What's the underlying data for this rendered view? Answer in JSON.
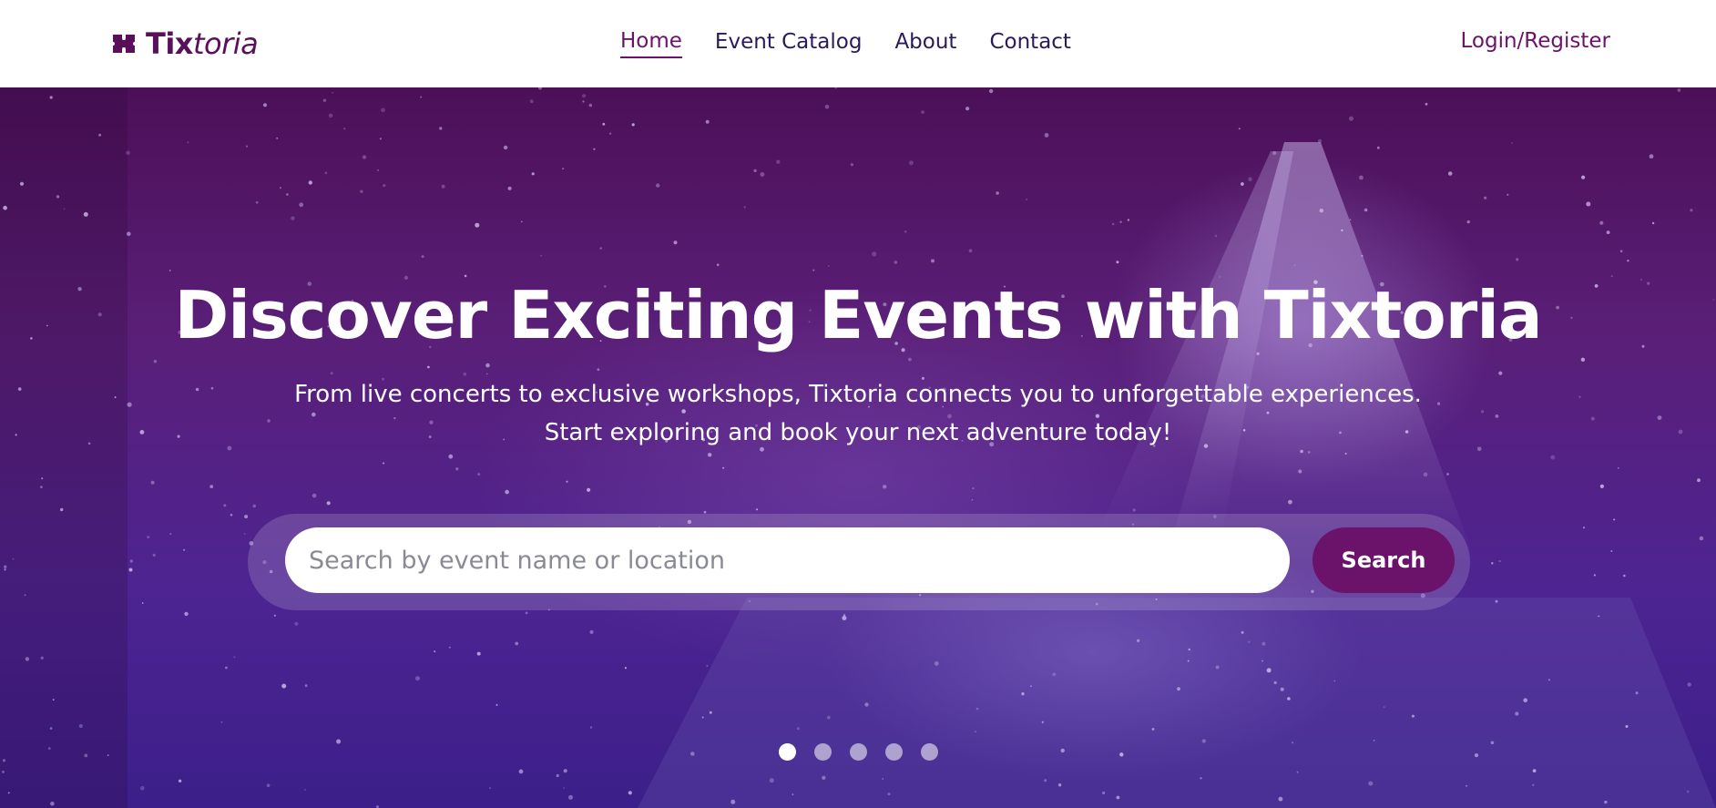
{
  "brand": {
    "name_bold": "Tix",
    "name_italic": "toria",
    "icon": "ticket-icon",
    "color": "#5a0f5a"
  },
  "nav": {
    "items": [
      {
        "label": "Home",
        "active": true
      },
      {
        "label": "Event Catalog",
        "active": false
      },
      {
        "label": "About",
        "active": false
      },
      {
        "label": "Contact",
        "active": false
      }
    ],
    "auth_label": "Login/Register"
  },
  "hero": {
    "title": "Discover Exciting Events with Tixtoria",
    "subtitle_line1": "From live concerts to exclusive workshops, Tixtoria connects you to unforgettable experiences.",
    "subtitle_line2": "Start exploring and book your next adventure today!"
  },
  "search": {
    "placeholder": "Search by event name or location",
    "value": "",
    "button_label": "Search"
  },
  "carousel": {
    "slides": 5,
    "active_index": 0
  },
  "colors": {
    "accent": "#6b126b",
    "nav_text": "#2a1a5a"
  }
}
